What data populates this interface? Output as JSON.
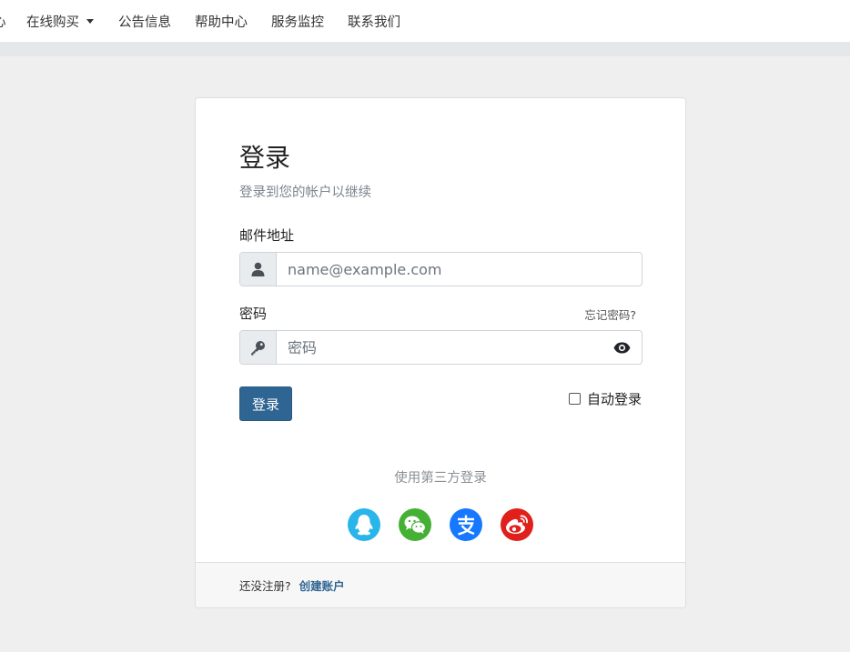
{
  "nav": {
    "items": [
      {
        "label": "心"
      },
      {
        "label": "在线购买"
      },
      {
        "label": "公告信息"
      },
      {
        "label": "帮助中心"
      },
      {
        "label": "服务监控"
      },
      {
        "label": "联系我们"
      }
    ]
  },
  "login": {
    "title": "登录",
    "subtitle": "登录到您的帐户以继续",
    "email_label": "邮件地址",
    "email_placeholder": "name@example.com",
    "email_value": "",
    "password_label": "密码",
    "forgot_link": "忘记密码?",
    "password_placeholder": "密码",
    "password_value": "",
    "submit_label": "登录",
    "remember_label": "自动登录",
    "remember_checked": false,
    "third_party_label": "使用第三方登录",
    "social": [
      {
        "icon": "qq-icon",
        "color": "#29b5ea"
      },
      {
        "icon": "wechat-icon",
        "color": "#44b034"
      },
      {
        "icon": "alipay-icon",
        "color": "#1678ff"
      },
      {
        "icon": "weibo-icon",
        "color": "#e0201b"
      }
    ]
  },
  "footer": {
    "prompt": "还没注册?",
    "create_link": "创建账户"
  },
  "colors": {
    "primary": "#2f6592",
    "page_bg": "#efefef"
  }
}
